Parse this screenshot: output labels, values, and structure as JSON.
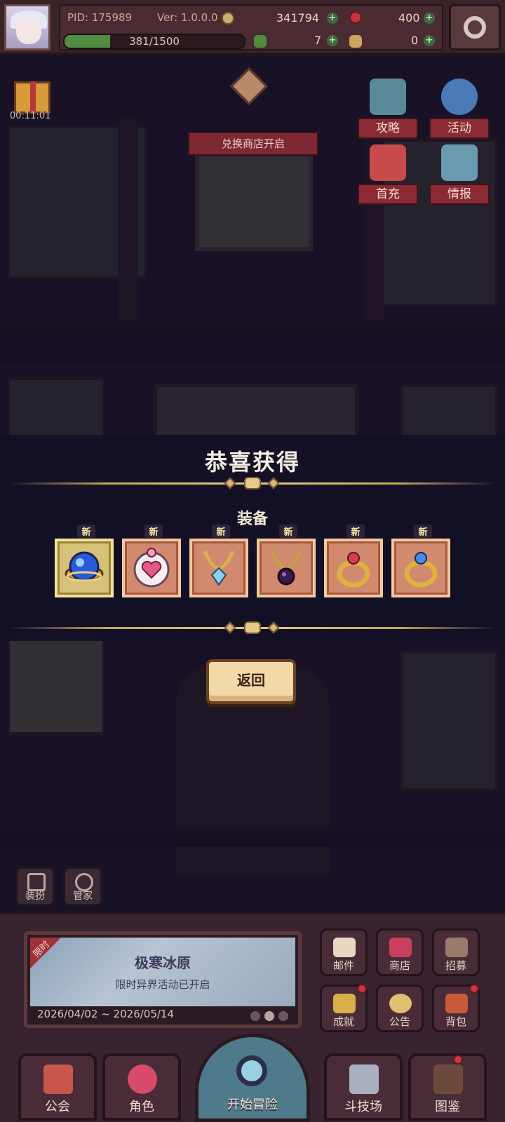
{
  "player": {
    "pid": "PID: 175989",
    "version": "Ver: 1.0.0.0",
    "gold": "341794",
    "gems": "400",
    "exp": "381/1500",
    "exp_fraction": 0.254,
    "clover": "7",
    "other": "0"
  },
  "scene": {
    "timer": "00:11:01",
    "shop_banner": "兑换商店开启",
    "right_buttons": [
      "攻略",
      "活动",
      "首充",
      "情报"
    ]
  },
  "reward": {
    "title": "恭喜获得",
    "category": "装备",
    "new_label": "新",
    "items": [
      {
        "name": "blue-orb-icon"
      },
      {
        "name": "pink-heart-charm-icon"
      },
      {
        "name": "blue-gem-necklace-icon"
      },
      {
        "name": "dark-gem-necklace-icon"
      },
      {
        "name": "red-gem-ring-icon"
      },
      {
        "name": "blue-gem-ring-icon"
      }
    ],
    "back_label": "返回"
  },
  "side_buttons": [
    "装扮",
    "管家"
  ],
  "event": {
    "ribbon": "限时",
    "title": "极寒冰原",
    "subtitle": "限时异界活动已开启",
    "dates": "2026/04/02 ~ 2026/05/14"
  },
  "menu": [
    "邮件",
    "商店",
    "招募",
    "成就",
    "公告",
    "背包"
  ],
  "nav": {
    "guild": "公会",
    "character": "角色",
    "adventure": "开始冒险",
    "arena": "斗技场",
    "codex": "图鉴"
  },
  "colors": {
    "accent_red": "#8b2a34",
    "gold_trim": "#c9a45c",
    "item_bg": "#d18a6e",
    "item_highlight": "#d6c178"
  }
}
